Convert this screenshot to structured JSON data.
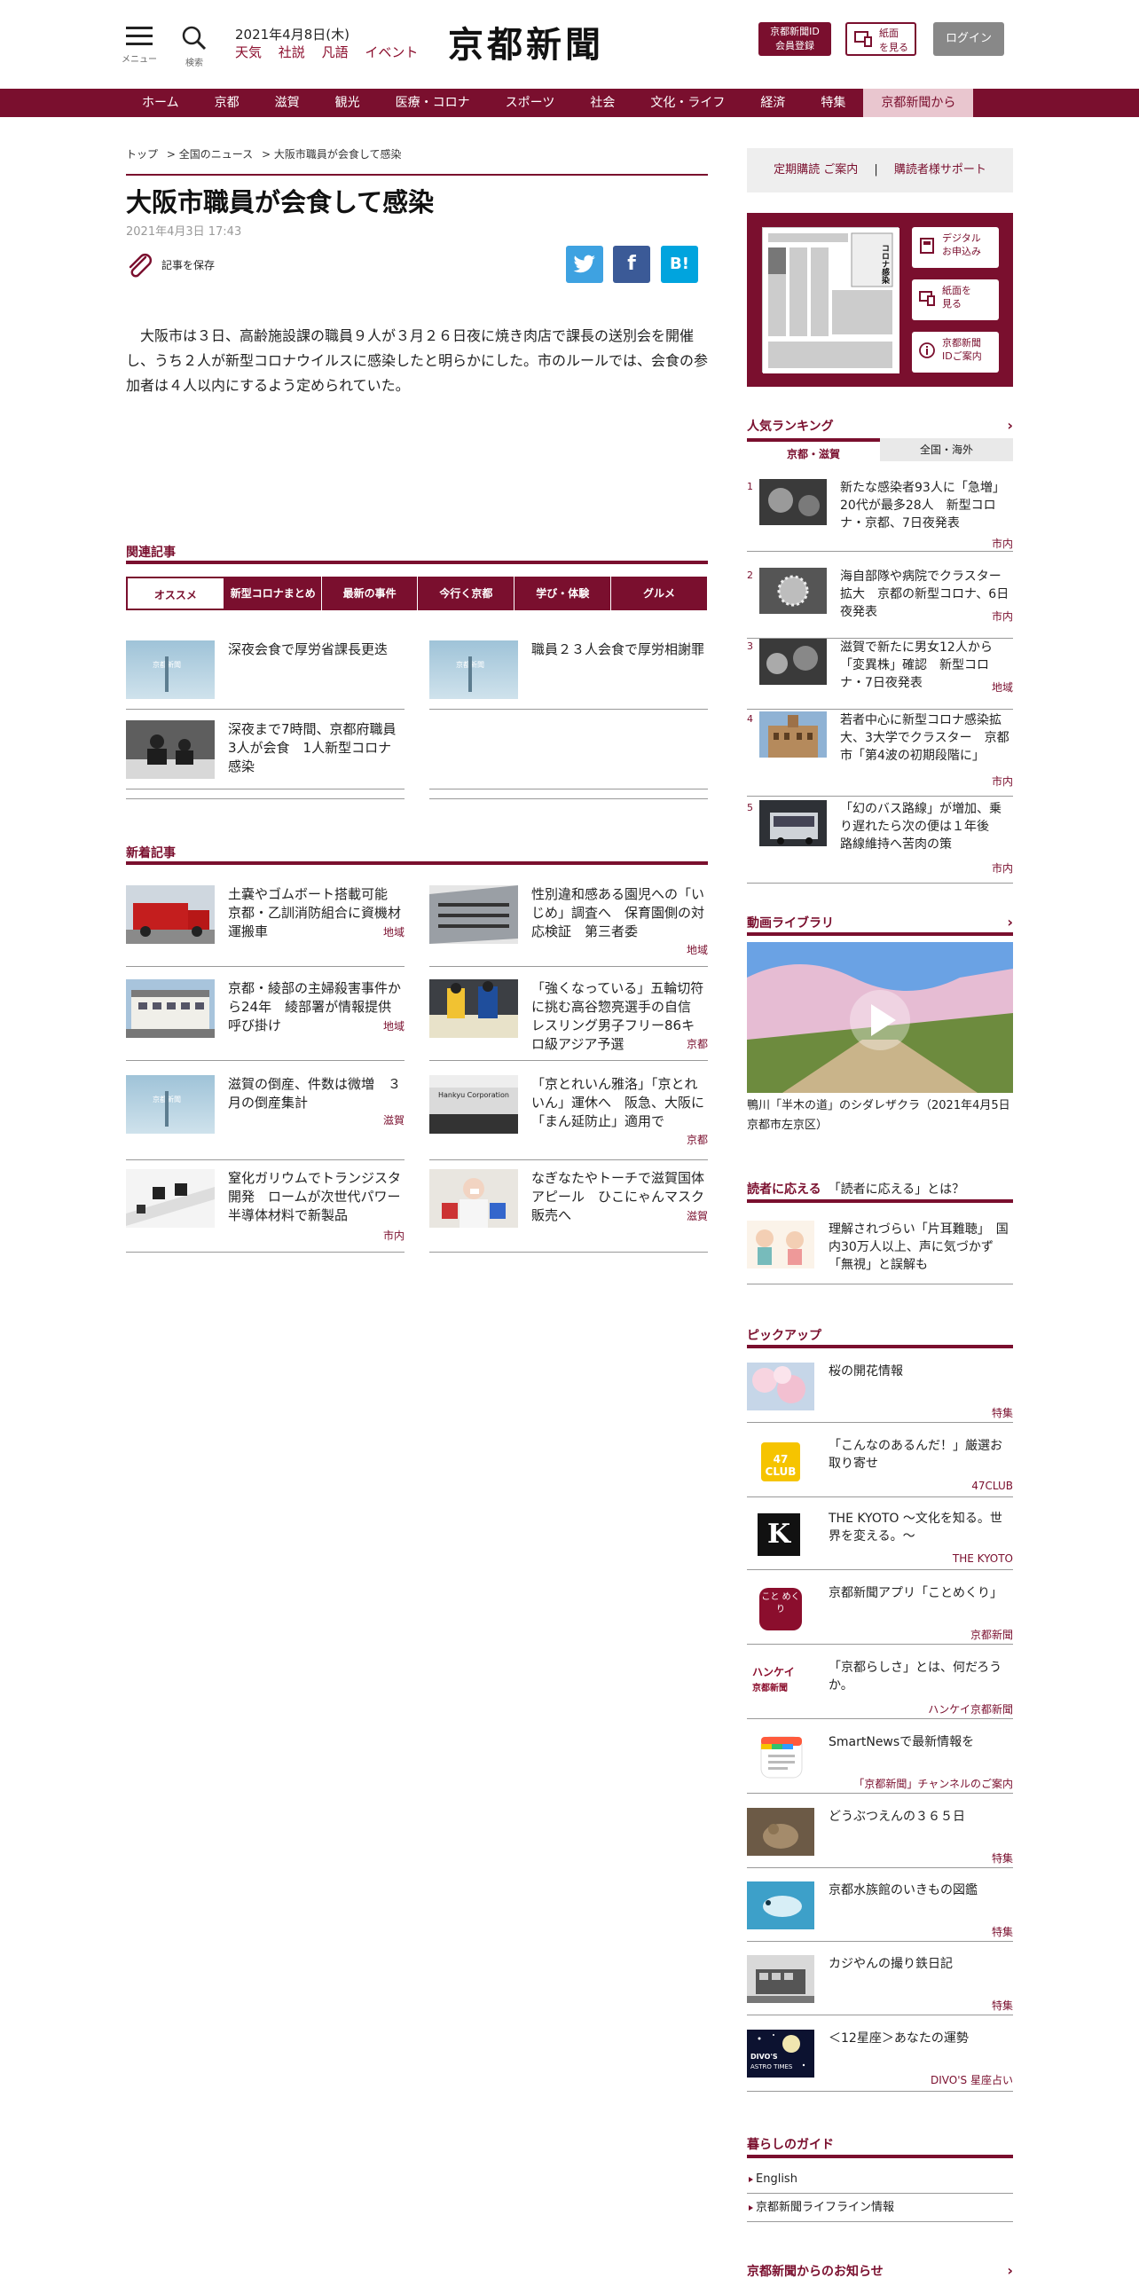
{
  "header": {
    "menu_caption": "メニュー",
    "search_caption": "検索",
    "date": "2021年4月8日(木)",
    "links": [
      "天気",
      "社説",
      "凡語",
      "イベント"
    ],
    "logo": "京都新聞",
    "member_button": "京都新聞ID会員登録",
    "member_line1": "京都新聞ID",
    "member_line2": "会員登録",
    "paper_line1": "紙面",
    "paper_line2": "を見る",
    "login_button": "ログイン"
  },
  "nav": {
    "items": [
      "ホーム",
      "京都",
      "滋賀",
      "観光",
      "医療・コロナ",
      "スポーツ",
      "社会",
      "文化・ライフ",
      "経済",
      "特集",
      "京都新聞から"
    ],
    "active": "京都新聞から"
  },
  "breadcrumb": [
    "トップ",
    "> 全国のニュース",
    "> 大阪市職員が会食して感染"
  ],
  "article": {
    "title": "大阪市職員が会食して感染",
    "date": "2021年4月3日 17:43",
    "save_label": "記事を保存",
    "share": {
      "twitter": "t",
      "facebook": "f",
      "hatena": "B!"
    },
    "body": "大阪市は３日、高齢施設課の職員９人が３月２６日夜に焼き肉店で課長の送別会を開催し、うち２人が新型コロナウイルスに感染したと明らかにした。市のルールでは、会食の参加者は４人以内にするよう定められていた。"
  },
  "related": {
    "heading": "関連記事",
    "tabs": [
      "オススメ",
      "新型コロナまとめ",
      "最新の事件",
      "今行く京都",
      "学び・体験",
      "グルメ"
    ],
    "selected_tab": "オススメ",
    "cards": [
      {
        "title": "深夜会食で厚労省課長更迭",
        "thumb": "京都新聞"
      },
      {
        "title": "職員２３人会食で厚労相謝罪",
        "thumb": "京都新聞"
      },
      {
        "title": "深夜まで7時間、京都府職員3人が会食　1人新型コロナ感染",
        "thumb": ""
      }
    ]
  },
  "latest": {
    "heading": "新着記事",
    "cards": [
      {
        "title": "土嚢やゴムボート搭載可能　京都・乙訓消防組合に資機材運搬車",
        "tag": "地域"
      },
      {
        "title": "性別違和感ある園児への「いじめ」調査へ　保育園側の対応検証　第三者委",
        "tag": "地域"
      },
      {
        "title": "京都・綾部の主婦殺害事件から24年　綾部署が情報提供呼び掛け",
        "tag": "地域"
      },
      {
        "title": "「強くなっている」五輪切符に挑む高谷惣亮選手の自信　レスリング男子フリー86キロ級アジア予選",
        "tag": "京都"
      },
      {
        "title": "滋賀の倒産、件数は微増　３月の倒産集計",
        "tag": "滋賀",
        "thumb": "京都新聞"
      },
      {
        "title": "「京とれいん雅洛」「京とれいん」運休へ　阪急、大阪に「まん延防止」適用で",
        "tag": "京都",
        "thumb_text": "Hankyu Corporation"
      },
      {
        "title": "窒化ガリウムでトランジスタ開発　ロームが次世代パワー半導体材料で新製品",
        "tag": "市内"
      },
      {
        "title": "なぎなたやトーチで滋賀国体アピール　ひこにゃんマスク販売へ",
        "tag": "滋賀"
      }
    ]
  },
  "sidebar": {
    "subscribe": "定期購読 ご案内",
    "separator": "|",
    "support": "購読者様サポート",
    "paper_buttons": [
      {
        "l1": "デジタル",
        "l2": "お申込み"
      },
      {
        "l1": "紙面を",
        "l2": "見る"
      },
      {
        "l1": "京都新聞",
        "l2": "IDご案内"
      }
    ],
    "paper_text": "コロナ感染",
    "ranking": {
      "heading": "人気ランキング",
      "tab_local": "京都・滋賀",
      "tab_national": "全国・海外",
      "items": [
        {
          "num": "1",
          "title": "新たな感染者93人に「急増」20代が最多28人　新型コロナ・京都、7日夜発表",
          "tag": "市内"
        },
        {
          "num": "2",
          "title": "海自部隊や病院でクラスター拡大　京都の新型コロナ、6日夜発表",
          "tag": "市内"
        },
        {
          "num": "3",
          "title": "滋賀で新たに男女12人から「変異株」確認　新型コロナ・7日夜発表",
          "tag": "地域"
        },
        {
          "num": "4",
          "title": "若者中心に新型コロナ感染拡大、3大学でクラスター　京都市「第4波の初期段階に」",
          "tag": "市内"
        },
        {
          "num": "5",
          "title": "「幻のバス路線」が増加、乗り遅れたら次の便は１年後　路線維持へ苦肉の策",
          "tag": "市内"
        }
      ]
    },
    "video": {
      "heading": "動画ライブラリ",
      "caption": "鴨川「半木の道」のシダレザクラ（2021年4月5日　京都市左京区）"
    },
    "reader": {
      "heading_bold": "読者に応える",
      "heading_rest": "「読者に応える」とは？",
      "title": "理解されづらい「片耳難聴」　国内30万人以上、声に気づかず「無視」と誤解も"
    },
    "pickup": {
      "heading": "ピックアップ",
      "items": [
        {
          "title": "桜の開花情報",
          "tag": "特集"
        },
        {
          "title": "「こんなのあるんだ！」厳選お取り寄せ",
          "tag": "47CLUB",
          "logo": "47 CLUB"
        },
        {
          "title": "THE KYOTO ～文化を知る。世界を変える。～",
          "tag": "THE KYOTO",
          "logo": "K"
        },
        {
          "title": "京都新聞アプリ「ことめくり」",
          "tag": "京都新聞",
          "logo": "こと めく り"
        },
        {
          "title": "「京都らしさ」とは、何だろうか。",
          "tag": "ハンケイ京都新聞",
          "logo1": "ハンケイ",
          "logo2": "京都新聞"
        },
        {
          "title": "SmartNewsで最新情報を",
          "tag": "「京都新聞」チャンネルのご案内"
        },
        {
          "title": "どうぶつえんの３６５日",
          "tag": "特集"
        },
        {
          "title": "京都水族館のいきもの図鑑",
          "tag": "特集"
        },
        {
          "title": "カジやんの撮り鉄日記",
          "tag": "特集"
        },
        {
          "title": "＜12星座＞あなたの運勢",
          "tag": "DIVO'S 星座占い",
          "logo1": "DIVO'S",
          "logo2": "ASTRO TIMES"
        }
      ]
    },
    "guide": {
      "heading": "暮らしのガイド",
      "items": [
        "English",
        "京都新聞ライフライン情報"
      ]
    },
    "notice": {
      "heading": "京都新聞からのお知らせ"
    }
  },
  "colors": {
    "brand": "#7a0f2e",
    "twitter": "#3ea2e1",
    "facebook": "#3b5a97",
    "hatena": "#00a4de"
  }
}
